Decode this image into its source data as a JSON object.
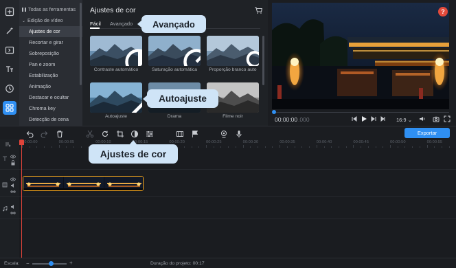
{
  "sidebar": {
    "items": [
      {
        "label": "Todas as ferramentas",
        "kind": "top"
      },
      {
        "label": "Edição de vídeo",
        "kind": "top"
      },
      {
        "label": "Ajustes de cor",
        "kind": "selected"
      },
      {
        "label": "Recortar e girar",
        "kind": "item"
      },
      {
        "label": "Sobreposição",
        "kind": "item"
      },
      {
        "label": "Pan e zoom",
        "kind": "item"
      },
      {
        "label": "Estabilização",
        "kind": "item"
      },
      {
        "label": "Animação",
        "kind": "item"
      },
      {
        "label": "Destacar e ocultar",
        "kind": "item"
      },
      {
        "label": "Chroma key",
        "kind": "item"
      },
      {
        "label": "Detecção de cena",
        "kind": "item"
      }
    ]
  },
  "panel": {
    "title": "Ajustes de cor",
    "tabs": [
      "Fácil",
      "Avançado"
    ],
    "active_tab": "Fácil",
    "presets": [
      {
        "label": "Contraste automático",
        "icon": "contrast-icon"
      },
      {
        "label": "Saturação automática",
        "icon": "saturation-icon"
      },
      {
        "label": "Proporção branco auto",
        "icon": "white-balance-icon"
      },
      {
        "label": "Autoajuste",
        "icon": "magic-wand-icon"
      },
      {
        "label": "Drama",
        "icon": "none"
      },
      {
        "label": "Filme noir",
        "icon": "none"
      }
    ]
  },
  "callouts": {
    "advanced": "Avançado",
    "autoadjust": "Autoajuste",
    "color_adjust": "Ajustes de cor"
  },
  "preview": {
    "timecode": "00:00:00",
    "timecode_frames": ".000",
    "aspect_ratio": "16:9",
    "help": "?"
  },
  "toolbar": {
    "export_label": "Exportar"
  },
  "ruler": {
    "labels": [
      "00:00:00",
      "00:00:05",
      "00:00:10",
      "00:00:15",
      "00:00:20",
      "00:00:25",
      "00:00:30",
      "00:00:35",
      "00:00:40",
      "00:00:45",
      "00:00:50",
      "00:00:55"
    ]
  },
  "footer": {
    "scale_label": "Escala:",
    "zoom_level": 0.55,
    "duration": "Duração do projeto: 00:17"
  },
  "colors": {
    "accent": "#2f8ff2",
    "clip_border": "#f3a51c",
    "callout_bg": "#cfe4f7",
    "playhead": "#e0443a"
  }
}
